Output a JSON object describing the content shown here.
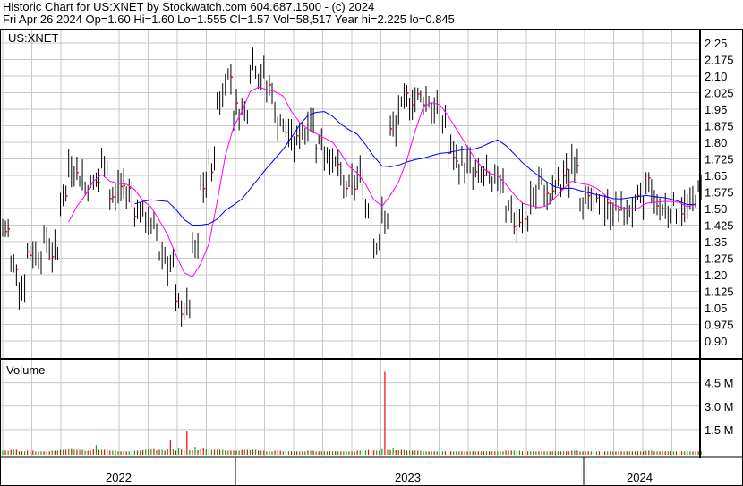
{
  "header": {
    "line1": "Historic Chart for US:XNET by Stockwatch.com 604.687.1500 - (c) 2024",
    "line2": "Fri Apr 26 2024  Op=1.60  Hi=1.60  Lo=1.555  Cl=1.57  Vol=58,517  Year hi=2.225  lo=0.845"
  },
  "colors": {
    "bars": "#000000",
    "close_tick": "#ff0000",
    "ma_short": "#ff00ff",
    "ma_long": "#0000ff",
    "volume_up": "#00aa00",
    "volume_down": "#ff0000",
    "grid": "#c8c8c8"
  },
  "chart_data": [
    {
      "type": "line",
      "title": "US:XNET",
      "subtype": "ohlc-bars with moving averages",
      "ylim": [
        0.85,
        2.28
      ],
      "y_ticks": [
        "2.25",
        "2.175",
        "2.10",
        "2.025",
        "1.95",
        "1.875",
        "1.80",
        "1.725",
        "1.65",
        "1.575",
        "1.50",
        "1.425",
        "1.35",
        "1.275",
        "1.20",
        "1.125",
        "1.05",
        "0.975",
        "0.90"
      ],
      "x_labels": [
        "2022",
        "2023",
        "2024"
      ],
      "closes": [
        1.4,
        1.25,
        1.15,
        1.3,
        1.3,
        1.35,
        1.3,
        1.55,
        1.7,
        1.65,
        1.6,
        1.62,
        1.7,
        1.55,
        1.6,
        1.58,
        1.5,
        1.45,
        1.4,
        1.3,
        1.25,
        1.05,
        1.05,
        1.3,
        1.6,
        1.7,
        2.0,
        2.1,
        1.95,
        1.95,
        2.15,
        2.1,
        2.05,
        1.9,
        1.85,
        1.8,
        1.85,
        1.9,
        1.8,
        1.75,
        1.7,
        1.6,
        1.6,
        1.65,
        1.5,
        1.35,
        1.45,
        1.85,
        1.95,
        2.0,
        2.0,
        2.0,
        1.95,
        1.9,
        1.75,
        1.7,
        1.7,
        1.65,
        1.65,
        1.6,
        1.65,
        1.5,
        1.42,
        1.45,
        1.55,
        1.6,
        1.55,
        1.6,
        1.65,
        1.72,
        1.55,
        1.52,
        1.52,
        1.5,
        1.5,
        1.48,
        1.5,
        1.52,
        1.62,
        1.52,
        1.5,
        1.5,
        1.5,
        1.52,
        1.57
      ],
      "series": [
        {
          "name": "short moving average"
        },
        {
          "name": "long moving average"
        }
      ]
    },
    {
      "type": "bar",
      "title": "Volume",
      "y_ticks": [
        "4.5 M",
        "3.0 M",
        "1.5 M"
      ],
      "ylim": [
        0,
        5.8
      ],
      "values_millions": [
        0.15,
        0.2,
        0.1,
        0.15,
        0.1,
        0.1,
        0.15,
        0.2,
        0.25,
        0.2,
        0.15,
        0.5,
        0.2,
        0.15,
        0.1,
        0.1,
        0.15,
        0.2,
        0.25,
        0.2,
        0.8,
        0.3,
        1.4,
        0.4,
        0.3,
        0.2,
        0.2,
        0.15,
        0.15,
        0.2,
        0.2,
        0.15,
        0.1,
        0.15,
        0.1,
        0.1,
        0.1,
        0.15,
        0.1,
        0.1,
        0.1,
        0.1,
        0.1,
        0.15,
        0.2,
        0.15,
        5.2,
        0.3,
        0.2,
        0.15,
        0.15,
        0.1,
        0.1,
        0.1,
        0.1,
        0.1,
        0.1,
        0.1,
        0.1,
        0.1,
        0.1,
        0.15,
        0.15,
        0.1,
        0.1,
        0.1,
        0.1,
        0.1,
        0.1,
        0.15,
        0.1,
        0.1,
        0.1,
        0.1,
        0.1,
        0.1,
        0.1,
        0.1,
        0.15,
        0.1,
        0.1,
        0.1,
        0.1,
        0.1,
        0.1
      ]
    }
  ]
}
